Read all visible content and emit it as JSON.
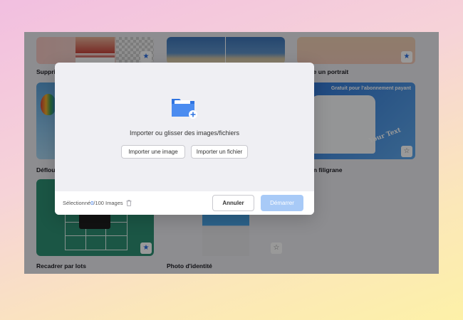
{
  "cards": [
    {
      "label": "Suppri",
      "star": "filled"
    },
    {
      "label": "",
      "star": "none"
    },
    {
      "label": "e nette un portrait",
      "star": "filled"
    },
    {
      "label": "Déflou",
      "star": "none"
    },
    {
      "label": "r un filigrane",
      "star": "outline",
      "badge": "Gratuit pour l'abonnement payant",
      "tshirt_text": "Your Text"
    },
    {
      "label": "Recadrer par lots",
      "star": "filled"
    },
    {
      "label": "Photo d'identité",
      "star": "outline"
    }
  ],
  "modal": {
    "title": "Importer ou glisser des images/fichiers",
    "import_image_label": "Importer une image",
    "import_file_label": "Importer un fichier",
    "selected_prefix": "Sélectionné ",
    "selected_count": "0",
    "selected_suffix": "/100 Images",
    "cancel_label": "Annuler",
    "start_label": "Démarrer"
  },
  "colors": {
    "accent": "#2b6fe3",
    "start_disabled": "#a8caf7",
    "watermark_card": "#3a86e0",
    "crop_card": "#2e8f74"
  },
  "icons": [
    "folder-upload-icon",
    "trash-icon",
    "star-icon"
  ]
}
